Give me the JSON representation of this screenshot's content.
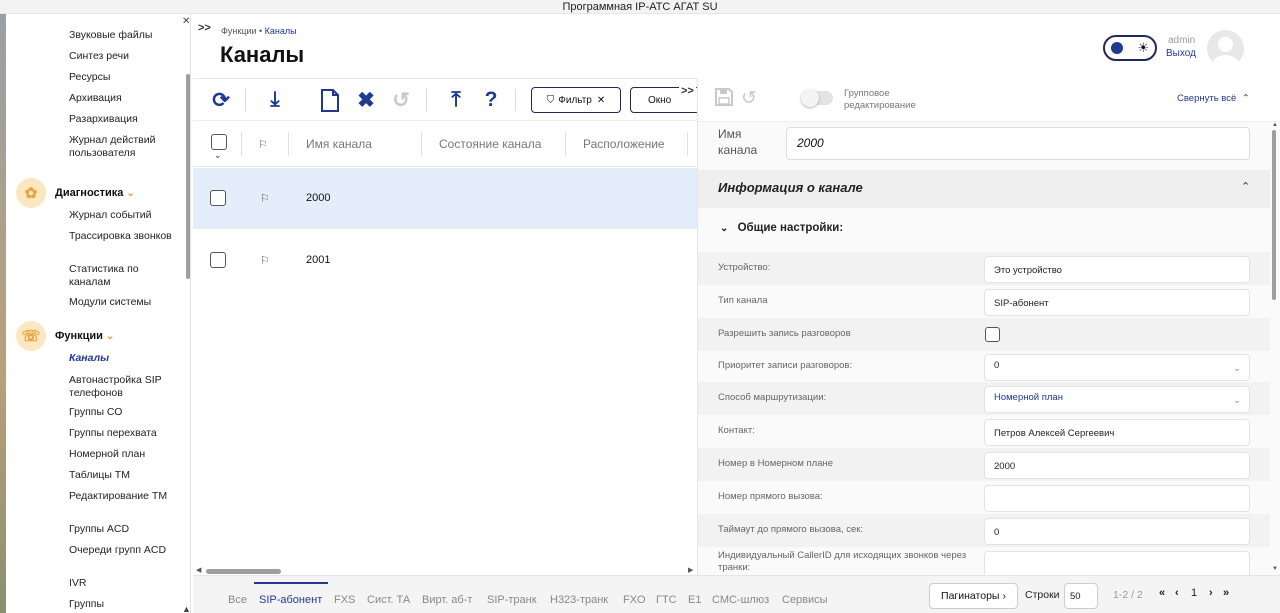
{
  "window": {
    "title": "Программная IP-АТС АГАТ SU"
  },
  "sidebar": {
    "top_items": [
      {
        "label": "Звуковые файлы"
      },
      {
        "label": "Синтез речи"
      },
      {
        "label": "Ресурсы"
      },
      {
        "label": "Архивация"
      },
      {
        "label": "Разархивация"
      },
      {
        "label": "Журнал действий пользователя"
      }
    ],
    "group_diag": {
      "label": "Диагностика",
      "items": [
        {
          "label": "Журнал событий"
        },
        {
          "label": "Трассировка звонков"
        },
        {
          "label": "Статистика по каналам"
        },
        {
          "label": "Модули системы"
        }
      ]
    },
    "group_func": {
      "label": "Функции",
      "items": [
        {
          "label": "Каналы",
          "active": true
        },
        {
          "label": "Автонастройка SIP телефонов"
        },
        {
          "label": "Группы СО"
        },
        {
          "label": "Группы перехвата"
        },
        {
          "label": "Номерной план"
        },
        {
          "label": "Таблицы ТМ"
        },
        {
          "label": "Редактирование ТМ"
        },
        {
          "label": "Группы ACD"
        },
        {
          "label": "Очереди групп ACD"
        },
        {
          "label": "IVR"
        },
        {
          "label": "Группы"
        }
      ]
    }
  },
  "header": {
    "breadcrumb": {
      "parent": "Функции",
      "sep": "•",
      "current": "Каналы"
    },
    "title": "Каналы",
    "user": {
      "name": "admin",
      "logout": "Выход"
    }
  },
  "toolbar": {
    "filter_label": "Фильтр",
    "window_label": "Окно"
  },
  "grid": {
    "columns": [
      "Имя канала",
      "Состояние канала",
      "Расположение"
    ],
    "rows": [
      {
        "name": "2000",
        "selected": true
      },
      {
        "name": "2001",
        "selected": false
      }
    ]
  },
  "detail": {
    "group_edit_label": "Групповое редактирование",
    "collapse_all": "Свернуть всё",
    "name_label": "Имя канала",
    "name_value": "2000",
    "section_title": "Информация о канале",
    "subsection_title": "Общие настройки:",
    "fields": [
      {
        "label": "Устройство:",
        "value": "Это устройство"
      },
      {
        "label": "Тип канала",
        "value": "SIP-абонент"
      },
      {
        "label": "Разрешить запись разговоров",
        "value": ""
      },
      {
        "label": "Приоритет записи разговоров:",
        "value": "0"
      },
      {
        "label": "Способ маршрутизации:",
        "value": "Номерной план"
      },
      {
        "label": "Контакт:",
        "value": "Петров Алексей Сергеевич"
      },
      {
        "label": "Номер в Номерном плане",
        "value": "2000"
      },
      {
        "label": "Номер прямого вызова:",
        "value": ""
      },
      {
        "label": "Таймаут до прямого вызова, сек:",
        "value": "0"
      },
      {
        "label": "Индивидуальный CallerID для исходящих звонков через транки:",
        "value": ""
      }
    ]
  },
  "bottom_tabs": [
    "Все",
    "SIP-абонент",
    "FXS",
    "Сист. ТА",
    "Вирт. аб-т",
    "SIP-транк",
    "H323-транк",
    "FXO",
    "ГТС",
    "E1",
    "СМС-шлюз",
    "Сервисы"
  ],
  "pagination": {
    "button": "Паги­наторы",
    "rows_label": "Строки",
    "rows_value": "50",
    "range": "1-2 / 2",
    "page": "1"
  },
  "colors": {
    "accent": "#1f3a93",
    "selected_row": "#e4eefb",
    "group_icon_bg": "#fde7c2"
  }
}
